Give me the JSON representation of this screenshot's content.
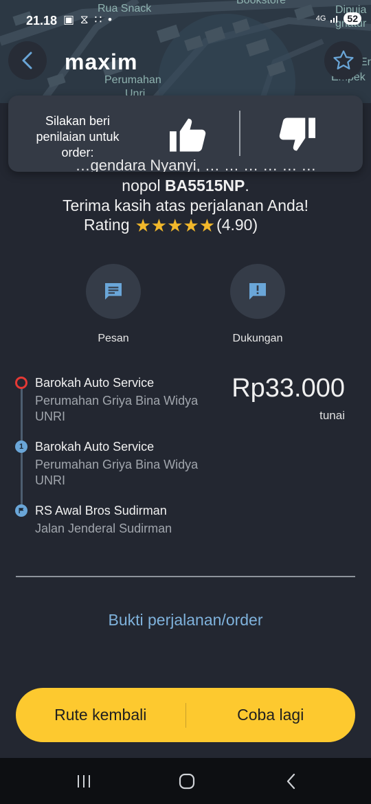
{
  "status": {
    "time": "21.18",
    "icons": "▣ ⧖ ∷ •",
    "network": "4G",
    "battery": "52"
  },
  "map": {
    "labels": [
      "Rua Snack",
      "Bookstore",
      "Dipuja",
      "Perumahan",
      "Unri",
      "Empek",
      "Er",
      "gnatur"
    ]
  },
  "header": {
    "logo": "maxim"
  },
  "rating_prompt": {
    "text": "Silakan beri penilaian untuk order:"
  },
  "driver": {
    "cut_text": "…gendara Nyanyi, … … … … … …",
    "plate_prefix": "nopol ",
    "plate": "BA5515NP",
    "plate_suffix": ".",
    "thanks": "Terima kasih atas perjalanan Anda!",
    "rating_label": "Rating",
    "rating_value": "(4.90)"
  },
  "actions": [
    {
      "label": "Pesan",
      "icon": "message-icon"
    },
    {
      "label": "Dukungan",
      "icon": "support-icon"
    }
  ],
  "route": {
    "stops": [
      {
        "name": "Barokah Auto Service",
        "address": "Perumahan Griya Bina Widya UNRI",
        "marker": ""
      },
      {
        "name": "Barokah Auto Service",
        "address": "Perumahan Griya Bina Widya UNRI",
        "marker": "1"
      },
      {
        "name": "RS Awal Bros Sudirman",
        "address": "Jalan Jenderal Sudirman",
        "marker": ""
      }
    ]
  },
  "fare": {
    "amount": "Rp33.000",
    "method": "tunai"
  },
  "proof_link": "Bukti perjalanan/order",
  "buttons": {
    "return_route": "Rute kembali",
    "retry": "Coba lagi"
  },
  "colors": {
    "accent": "#fdc92f",
    "background": "#232731",
    "link": "#7fb2dc",
    "star": "#f2b82b",
    "origin_marker": "#e53935"
  }
}
